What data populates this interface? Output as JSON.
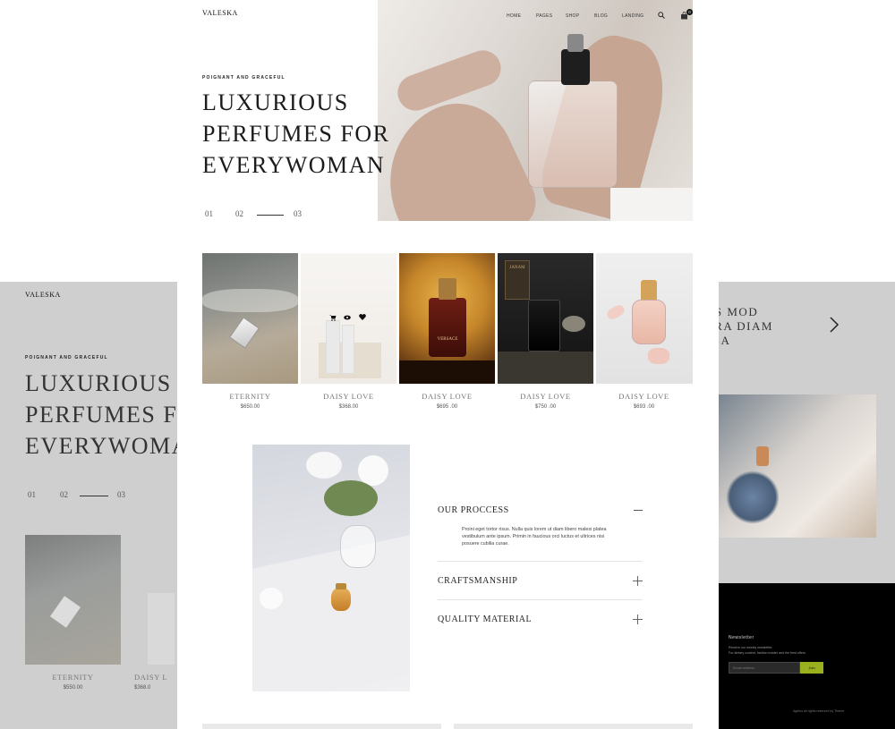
{
  "brand": "VALESKA",
  "nav": {
    "items": [
      "HOME",
      "PAGES",
      "SHOP",
      "BLOG",
      "LANDING"
    ],
    "cart_count": "0"
  },
  "hero": {
    "eyebrow": "POIGNANT AND GRACEFUL",
    "title_lines": [
      "LUXURIOUS",
      "PERFUMES FOR",
      "EVERYWOMAN"
    ],
    "slides": [
      "01",
      "02",
      "03"
    ]
  },
  "products": [
    {
      "name": "ETERNITY",
      "price": "$650.00"
    },
    {
      "name": "DAISY LOVE",
      "price": "$368.00"
    },
    {
      "name": "DAISY LOVE",
      "price": "$695 .00"
    },
    {
      "name": "DAISY LOVE",
      "price": "$750 .00"
    },
    {
      "name": "DAISY LOVE",
      "price": "$693 .00"
    }
  ],
  "bottle_label": "VERSACE",
  "jar_label": "JANAM",
  "accordion": [
    {
      "title": "OUR PROCCESS",
      "text": "Proini eget tortor risus. Nulla quis lorem ut diam libero malesi platea vestibulum ante ipsum. Primin in faucious orci luctus et ultrices nisi posuere cubilia curae."
    },
    {
      "title": "CRAFTSMANSHIP"
    },
    {
      "title": "QUALITY MATERIAL"
    }
  ],
  "left_preview": {
    "brand": "VALESKA",
    "eyebrow": "POIGNANT AND GRACEFUL",
    "title_lines": [
      "LUXURIOUS",
      "PERFUMES F",
      "EVERYWOMA"
    ],
    "slides": [
      "01",
      "02",
      "03"
    ],
    "products": [
      {
        "name": "ETERNITY",
        "price": "$550.00"
      },
      {
        "name": "DAISY L",
        "price": "$368.0"
      }
    ]
  },
  "right_preview": {
    "title_lines": [
      "US MOD",
      "RRA DIAM",
      "SSA"
    ],
    "newsletter": {
      "title": "Newsletter",
      "text_lines": [
        "Receive our weekly newsletter.",
        "For dietary content, fashion insider and the best offers."
      ],
      "placeholder": "Email address",
      "button": "Join"
    },
    "footer": "Agelus all rights reserved by Theme"
  }
}
